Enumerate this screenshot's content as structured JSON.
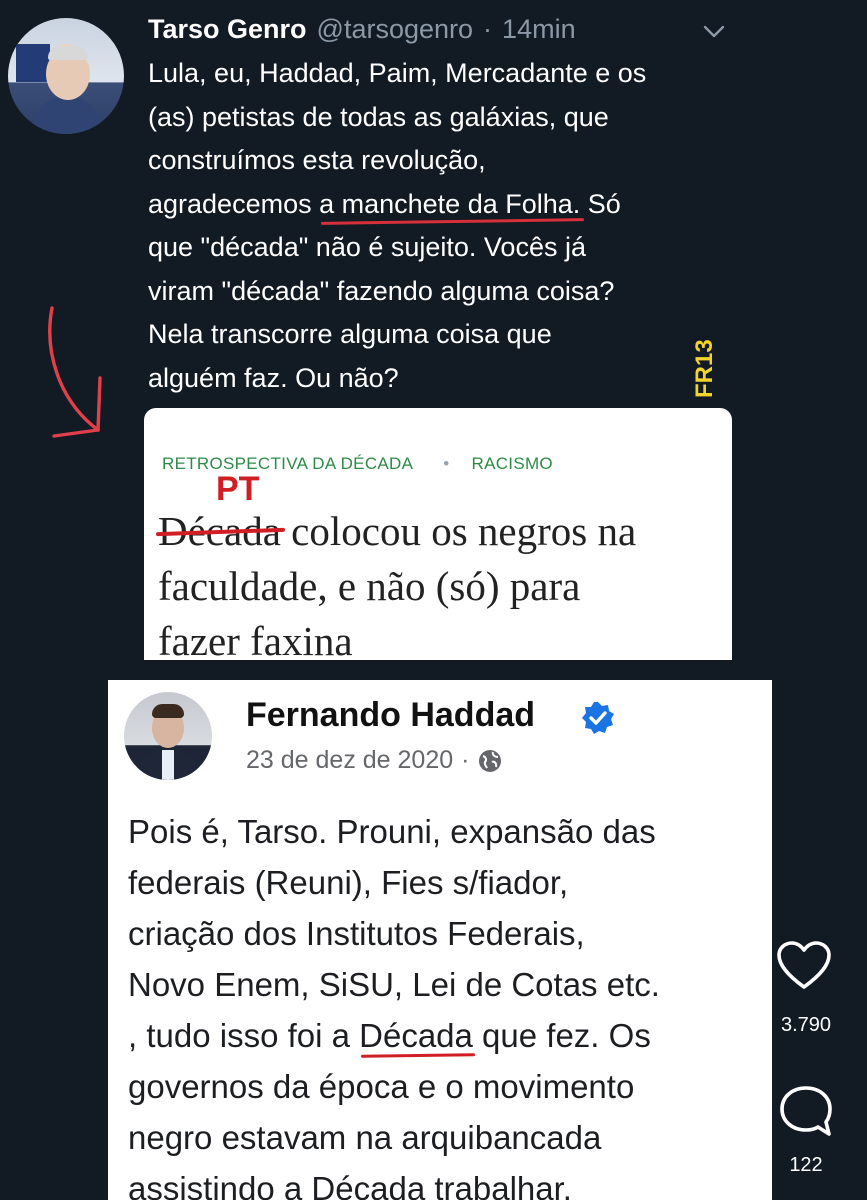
{
  "tweet": {
    "author_name": "Tarso Genro",
    "handle": "@tarsogenro",
    "separator": "·",
    "time": "14min",
    "lines": [
      "Lula, eu, Haddad, Paim, Mercadante e os",
      "(as) petistas de todas as galáxias, que",
      "construímos esta revolução,",
      "agradecemos ",
      "a manchete da Folha.",
      " Só",
      "que \"década\" não é sujeito. Vocês já",
      "viram \"década\" fazendo alguma coisa?",
      "Nela transcorre alguma coisa que",
      "alguém faz. Ou não?"
    ],
    "icons": {
      "avatar": "tarso-avatar",
      "menu": "chevron-down-icon"
    }
  },
  "watermark": "FR13",
  "news": {
    "tag_1": "RETROSPECTIVA DA DÉCADA",
    "tag_separator": "•",
    "tag_2": "RACISMO",
    "annotation": "PT",
    "struck_word": "Década",
    "headline_rest_1": " colocou os negros na",
    "headline_2": "faculdade, e não (só) para",
    "headline_3": "fazer faxina"
  },
  "post": {
    "author_name": "Fernando Haddad",
    "date": "23 de dez de 2020",
    "separator": "·",
    "lines": [
      "Pois é, Tarso. Prouni, expansão das",
      "federais (Reuni), Fies s/fiador,",
      "criação dos Institutos Federais,",
      "Novo Enem, SiSU, Lei de Cotas etc.",
      ", tudo isso foi a ",
      "Década",
      " que fez. Os",
      "governos da época e o movimento",
      "negro estavam na arquibancada",
      "assistindo a Década trabalhar."
    ],
    "icons": {
      "verified": "verified-badge-icon",
      "audience": "globe-icon"
    }
  },
  "actions": {
    "likes": "3.790",
    "comments": "122",
    "icons": {
      "like": "heart-icon",
      "comment": "comment-bubble-icon"
    }
  },
  "colors": {
    "background": "#121a24",
    "annotation_red": "#d11d24",
    "tag_green": "#2e8b47",
    "verified_blue": "#1b74e4"
  }
}
